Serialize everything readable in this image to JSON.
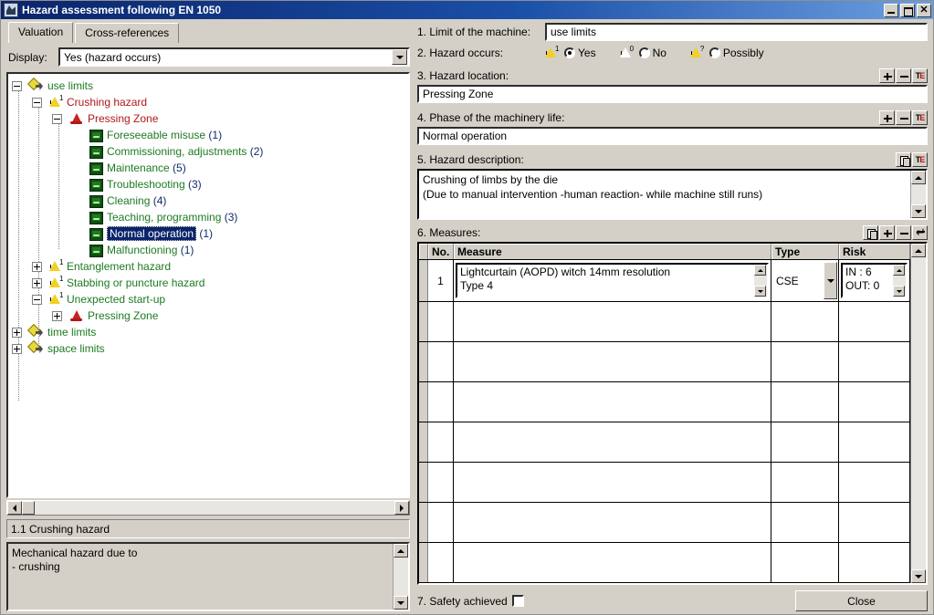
{
  "window": {
    "title": "Hazard assessment following EN 1050",
    "icon": "app-icon",
    "controls": {
      "minimize": "_",
      "maximize": "□",
      "close": "✕"
    }
  },
  "tabs": [
    {
      "label": "Valuation",
      "active": true
    },
    {
      "label": "Cross-references",
      "active": false
    }
  ],
  "display": {
    "label": "Display:",
    "value": "Yes (hazard occurs)"
  },
  "tree": [
    {
      "label": "use limits",
      "icon": "limits-icon",
      "level": 0,
      "expander": "minus",
      "style": "green",
      "count": ""
    },
    {
      "label": "Crushing hazard",
      "icon": "warning-icon",
      "sup": "1",
      "level": 1,
      "expander": "minus",
      "style": "red",
      "count": ""
    },
    {
      "label": "Pressing Zone",
      "icon": "cone-icon",
      "level": 2,
      "expander": "minus",
      "style": "red",
      "count": ""
    },
    {
      "label": "Foreseeable misuse",
      "icon": "phase-icon",
      "level": 3,
      "expander": "none",
      "style": "green",
      "count": "(1)"
    },
    {
      "label": "Commissioning, adjustments",
      "icon": "phase-icon",
      "level": 3,
      "expander": "none",
      "style": "green",
      "count": "(2)"
    },
    {
      "label": "Maintenance",
      "icon": "phase-icon",
      "level": 3,
      "expander": "none",
      "style": "green",
      "count": "(5)"
    },
    {
      "label": "Troubleshooting",
      "icon": "phase-icon",
      "level": 3,
      "expander": "none",
      "style": "green",
      "count": "(3)"
    },
    {
      "label": "Cleaning",
      "icon": "phase-icon",
      "level": 3,
      "expander": "none",
      "style": "green",
      "count": "(4)"
    },
    {
      "label": "Teaching, programming",
      "icon": "phase-icon",
      "level": 3,
      "expander": "none",
      "style": "green",
      "count": "(3)"
    },
    {
      "label": "Normal operation",
      "icon": "phase-icon",
      "level": 3,
      "expander": "none",
      "style": "selected",
      "count": "(1)"
    },
    {
      "label": "Malfunctioning",
      "icon": "phase-icon",
      "level": 3,
      "expander": "none",
      "style": "green",
      "count": "(1)"
    },
    {
      "label": "Entanglement hazard",
      "icon": "warning-icon",
      "sup": "1",
      "level": 1,
      "expander": "plus",
      "style": "green",
      "count": ""
    },
    {
      "label": "Stabbing or puncture hazard",
      "icon": "warning-icon",
      "sup": "1",
      "level": 1,
      "expander": "plus",
      "style": "green",
      "count": ""
    },
    {
      "label": "Unexpected start-up",
      "icon": "warning-icon",
      "sup": "1",
      "level": 1,
      "expander": "minus",
      "style": "green",
      "count": ""
    },
    {
      "label": "Pressing Zone",
      "icon": "cone-icon",
      "level": 2,
      "expander": "plus",
      "style": "green",
      "count": ""
    },
    {
      "label": "time limits",
      "icon": "limits-icon",
      "level": 0,
      "expander": "plus",
      "style": "green",
      "count": ""
    },
    {
      "label": "space limits",
      "icon": "limits-icon",
      "level": 0,
      "expander": "plus",
      "style": "green",
      "count": ""
    }
  ],
  "status_line": "1.1 Crushing hazard",
  "description": "Mechanical hazard due to\n- crushing",
  "sections": {
    "limit": {
      "label": "1. Limit of the machine:",
      "value": "use limits"
    },
    "occurs": {
      "label": "2. Hazard occurs:",
      "options": [
        {
          "label": "Yes",
          "icon": "warning-icon-yes",
          "sup": "1",
          "selected": true
        },
        {
          "label": "No",
          "icon": "warning-icon-no",
          "sup": "0",
          "selected": false
        },
        {
          "label": "Possibly",
          "icon": "warning-icon-possibly",
          "sup": "?",
          "selected": false
        }
      ]
    },
    "location": {
      "label": "3. Hazard location:",
      "value": "Pressing Zone",
      "buttons": [
        "add-icon",
        "remove-icon",
        "text-edit-icon"
      ]
    },
    "phase": {
      "label": "4. Phase of the machinery life:",
      "value": "Normal operation",
      "buttons": [
        "add-icon",
        "remove-icon",
        "text-edit-icon"
      ]
    },
    "hazard_description": {
      "label": "5. Hazard description:",
      "value": "Crushing of limbs by the die\n(Due to manual intervention -human reaction- while machine still runs)",
      "buttons": [
        "copy-icon",
        "text-edit-icon"
      ]
    },
    "measures": {
      "label": "6. Measures:",
      "buttons": [
        "copy-icon",
        "add-icon",
        "remove-icon",
        "enter-icon"
      ],
      "columns": [
        "",
        "No.",
        "Measure",
        "Type",
        "Risk"
      ],
      "rows": [
        {
          "no": "1",
          "measure": "Lightcurtain (AOPD) witch 14mm resolution\nType 4",
          "type": "CSE",
          "risk_in": "IN : 6",
          "risk_out": "OUT: 0"
        }
      ],
      "empty_row_count": 7
    },
    "safety": {
      "label": "7. Safety achieved",
      "checked": false
    }
  },
  "close_button": "Close",
  "colors": {
    "titlebar_start": "#0a246a",
    "titlebar_end": "#6c9fe0",
    "face": "#d4d0c8",
    "selection": "#0a246a",
    "tree_green": "#1d7a22",
    "tree_red": "#b01818",
    "count_blue": "#102a68",
    "warning_yellow": "#f2d024"
  }
}
